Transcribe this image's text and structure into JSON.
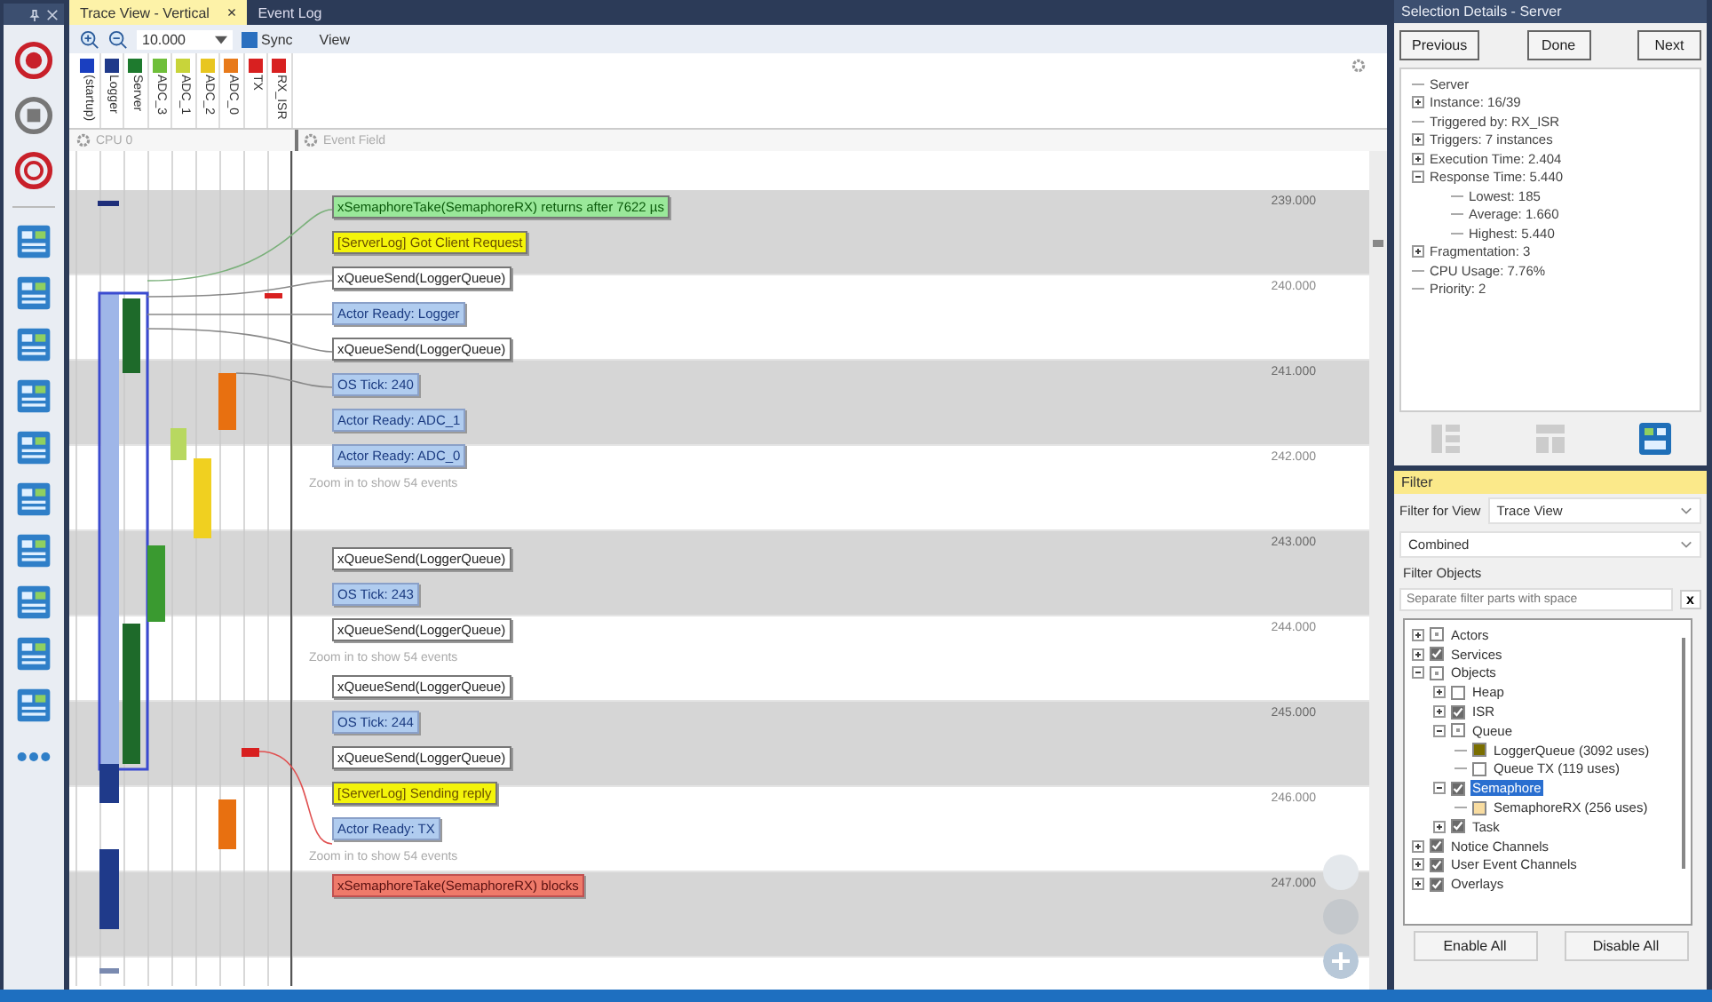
{
  "trace": {
    "tabs": [
      {
        "label": "Trace View - Vertical",
        "selected": true,
        "close": "×"
      },
      {
        "label": "Event Log",
        "selected": false
      }
    ],
    "zoom_value": "10.000",
    "sync_label": "Sync",
    "view_menu": "View",
    "actors": [
      {
        "name": "(startup)",
        "color": "#1a3fc0"
      },
      {
        "name": "Logger",
        "color": "#203a8a"
      },
      {
        "name": "Server",
        "color": "#1e7a2e"
      },
      {
        "name": "ADC_3",
        "color": "#6fbf3a"
      },
      {
        "name": "ADC_1",
        "color": "#c8d43a"
      },
      {
        "name": "ADC_2",
        "color": "#e8c620"
      },
      {
        "name": "ADC_0",
        "color": "#e87a1a"
      },
      {
        "name": "TX",
        "color": "#d82020"
      },
      {
        "name": "RX_ISR",
        "color": "#d82020"
      }
    ],
    "cpu_header": "CPU 0",
    "event_header": "Event Field",
    "time_marks": [
      "239.000",
      "240.000",
      "241.000",
      "242.000",
      "243.000",
      "244.000",
      "245.000",
      "246.000",
      "247.000"
    ],
    "event_groups": [
      {
        "items": [
          {
            "kind": "return",
            "text": "xSemaphoreTake(SemaphoreRX) returns after 7622 µs"
          },
          {
            "kind": "user",
            "text": "[ServerLog] Got Client Request"
          },
          {
            "kind": "service",
            "text": "xQueueSend(LoggerQueue)"
          },
          {
            "kind": "actor",
            "text": "Actor Ready: Logger"
          },
          {
            "kind": "service",
            "text": "xQueueSend(LoggerQueue)"
          },
          {
            "kind": "actor",
            "text": "OS Tick: 240"
          },
          {
            "kind": "actor",
            "text": "Actor Ready: ADC_1"
          },
          {
            "kind": "actor",
            "text": "Actor Ready: ADC_0"
          },
          {
            "kind": "note",
            "text": "Zoom in to show 54 events"
          }
        ]
      },
      {
        "items": [
          {
            "kind": "service",
            "text": "xQueueSend(LoggerQueue)"
          },
          {
            "kind": "actor",
            "text": "OS Tick: 243"
          },
          {
            "kind": "service",
            "text": "xQueueSend(LoggerQueue)"
          },
          {
            "kind": "note",
            "text": "Zoom in to show 54 events"
          },
          {
            "kind": "service",
            "text": "xQueueSend(LoggerQueue)"
          },
          {
            "kind": "actor",
            "text": "OS Tick: 244"
          },
          {
            "kind": "service",
            "text": "xQueueSend(LoggerQueue)"
          },
          {
            "kind": "user",
            "text": "[ServerLog] Sending reply"
          },
          {
            "kind": "actor",
            "text": "Actor Ready: TX"
          },
          {
            "kind": "note",
            "text": "Zoom in to show 54 events"
          },
          {
            "kind": "block",
            "text": "xSemaphoreTake(SemaphoreRX) blocks"
          }
        ]
      }
    ]
  },
  "selection_details": {
    "title": "Selection Details - Server",
    "buttons": [
      "Previous",
      "Done",
      "Next"
    ],
    "tree": [
      {
        "text": "Server"
      },
      {
        "text": "Instance: 16/39",
        "expanded": false
      },
      {
        "text": "Triggered by: RX_ISR"
      },
      {
        "text": "Triggers: 7 instances",
        "expanded": false
      },
      {
        "text": "Execution Time: 2.404",
        "expanded": false
      },
      {
        "text": "Response Time: 5.440",
        "expanded": true,
        "children": [
          {
            "text": "Lowest: 185"
          },
          {
            "text": "Average: 1.660"
          },
          {
            "text": "Highest: 5.440"
          }
        ]
      },
      {
        "text": "Fragmentation: 3",
        "expanded": false
      },
      {
        "text": "CPU Usage: 7.76%"
      },
      {
        "text": "Priority: 2"
      }
    ]
  },
  "filter": {
    "title": "Filter",
    "view_label": "Filter for View",
    "view_value": "Trace View",
    "mode_value": "Combined",
    "objects_label": "Filter Objects",
    "search": {
      "placeholder": "Separate filter parts with space"
    },
    "clear": "x",
    "tree": [
      {
        "text": "Actors",
        "expanded": false,
        "partial": true,
        "selected": false
      },
      {
        "text": "Services",
        "expanded": false,
        "checked": true,
        "partial": false,
        "selected": false
      },
      {
        "text": "Objects",
        "expanded": true,
        "partial": true,
        "selected": false,
        "children": [
          {
            "text": "Heap",
            "expanded": false,
            "checked": false,
            "partial": false,
            "selected": false
          },
          {
            "text": "ISR",
            "expanded": false,
            "checked": true,
            "partial": false,
            "selected": false
          },
          {
            "text": "Queue",
            "expanded": true,
            "partial": true,
            "selected": false,
            "children": [
              {
                "text": "LoggerQueue (3092 uses)",
                "color": "#7a6e00",
                "selected": false
              },
              {
                "text": "Queue TX (119 uses)",
                "color": "#ffffff",
                "selected": false
              }
            ]
          },
          {
            "text": "Semaphore",
            "expanded": true,
            "checked": true,
            "partial": false,
            "selected": true,
            "children": [
              {
                "text": "SemaphoreRX (256 uses)",
                "color": "#f8dca0",
                "selected": false
              }
            ]
          },
          {
            "text": "Task",
            "expanded": false,
            "checked": true,
            "partial": false,
            "selected": false
          }
        ]
      },
      {
        "text": "Notice Channels",
        "expanded": false,
        "checked": true,
        "partial": false,
        "selected": false
      },
      {
        "text": "User Event Channels",
        "expanded": false,
        "checked": true,
        "partial": false,
        "selected": false
      },
      {
        "text": "Overlays",
        "expanded": false,
        "checked": true,
        "partial": false,
        "selected": false
      }
    ],
    "buttons": [
      "Enable All",
      "Disable All"
    ]
  }
}
